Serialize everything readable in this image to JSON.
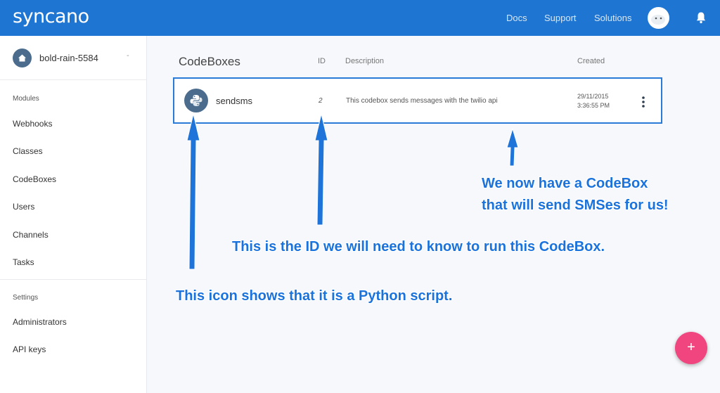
{
  "app": {
    "logo": "syncano",
    "nav": [
      "Docs",
      "Support",
      "Solutions"
    ]
  },
  "sidebar": {
    "instance": {
      "name": "bold-rain-5584",
      "caret": "-"
    },
    "modules_title": "Modules",
    "modules": [
      "Webhooks",
      "Classes",
      "CodeBoxes",
      "Users",
      "Channels",
      "Tasks"
    ],
    "settings_title": "Settings",
    "settings": [
      "Administrators",
      "API keys"
    ]
  },
  "main": {
    "title": "CodeBoxes",
    "columns": {
      "id": "ID",
      "description": "Description",
      "created": "Created"
    },
    "codebox": {
      "name": "sendsms",
      "id": "2",
      "description": "This codebox sends messages with the twilio api",
      "created_date": "29/11/2015",
      "created_time": "3:36:55 PM"
    }
  },
  "annotations": {
    "codebox_line1": "We now have a CodeBox",
    "codebox_line2": "that will send SMSes for us!",
    "id_note": "This is the ID we will need to know to run this CodeBox.",
    "icon_note": "This icon shows that it is a Python script."
  },
  "fab": {
    "label": "+"
  },
  "colors": {
    "topbar": "#1f76d2",
    "accent": "#2a7ad8",
    "fab": "#f0457f",
    "annotation": "#1a72dc"
  }
}
